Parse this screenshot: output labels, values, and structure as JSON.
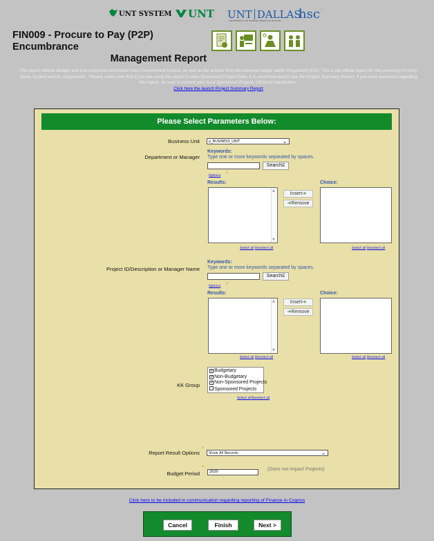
{
  "logos": {
    "unt_system": "UNT SYSTEM",
    "unt": "UNT",
    "unt_dallas_left": "UNT",
    "unt_dallas_right": "DALLAS",
    "unt_dallas_sub": "UNIVERSITY OF NORTH TEXAS AT DALLAS",
    "hsc": "hsc"
  },
  "header": {
    "title_line1": "FIN009 - Procure to Pay (P2P) Encumbrance",
    "title_line2": "Management Report"
  },
  "intro": {
    "text": "This report reflects Budget and Encumbrance information from Commitment Control, as well as the actuals from the General Ledger within PeopleSoft (EIS). This is the official report for the University of North Texas System and its components. *Please make note that if you are using this report to view Sponsored Project Data, It is recommended to use the Project Summary Report. If you have questions regarding this report, be sure to consult your local Sponsored Projects Office for clarification.",
    "link": "Click here the launch Project Summary Report"
  },
  "panel": {
    "heading": "Please Select Parameters Below:"
  },
  "business_unit": {
    "label": "Business Unit",
    "value": "p_BUSINESS_UNIT"
  },
  "dept": {
    "label": "Department or Manager",
    "keywords_label": "Keywords:",
    "keywords_hint": "Type one or more keywords separated by spaces.",
    "search_label": "Search",
    "options_link": "Options",
    "results_label": "Results:",
    "choice_label": "Choice:",
    "insert_label": "Insert",
    "remove_label": "Remove",
    "select_all": "Select all",
    "deselect_all": "Deselect all"
  },
  "project": {
    "label": "Project ID/Description or Manager Name",
    "keywords_label": "Keywords:",
    "keywords_hint": "Type one or more keywords separated by spaces.",
    "search_label": "Search",
    "options_link": "Options",
    "results_label": "Results:",
    "choice_label": "Choice:",
    "insert_label": "Insert",
    "remove_label": "Remove",
    "select_all": "Select all",
    "deselect_all": "Deselect all"
  },
  "kk_group": {
    "label": "KK Group",
    "options": [
      {
        "label": "Budgetary",
        "checked": true
      },
      {
        "label": "Non-Budgetary",
        "checked": true
      },
      {
        "label": "Non-Sponsored Projects",
        "checked": true
      },
      {
        "label": "Sponsored Projects",
        "checked": false
      }
    ],
    "select_all": "Select all",
    "deselect_all": "Deselect all"
  },
  "report_options": {
    "label": "Report Result Options",
    "value": "Show All Records"
  },
  "budget_period": {
    "label": "Budget Period",
    "value": "2020",
    "note": "(Does not impact Projects)"
  },
  "bottom_link": "Click here to be included in communication regarding reporting of Finance in Cognos",
  "footer": {
    "cancel": "Cancel",
    "finish": "Finish",
    "next": "Next >"
  }
}
